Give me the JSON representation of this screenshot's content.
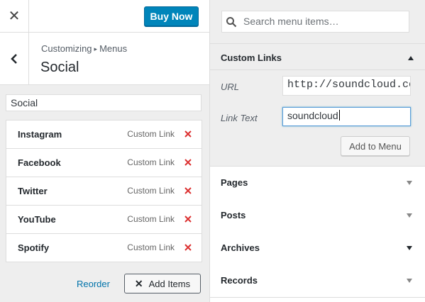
{
  "header": {
    "close_icon": "close-icon",
    "buy_label": "Buy Now",
    "buy_color": "#0085ba"
  },
  "title": {
    "breadcrumb_1": "Customizing",
    "breadcrumb_2": "Menus",
    "section": "Social"
  },
  "menu": {
    "name": "Social",
    "items": [
      {
        "label": "Instagram",
        "type": "Custom Link"
      },
      {
        "label": "Facebook",
        "type": "Custom Link"
      },
      {
        "label": "Twitter",
        "type": "Custom Link"
      },
      {
        "label": "YouTube",
        "type": "Custom Link"
      },
      {
        "label": "Spotify",
        "type": "Custom Link"
      }
    ],
    "delete_color": "#dc3232",
    "reorder_label": "Reorder",
    "add_items_label": "Add Items"
  },
  "search": {
    "placeholder": "Search menu items…"
  },
  "custom_links": {
    "title": "Custom Links",
    "url_label": "URL",
    "url_value": "http://soundcloud.co",
    "text_label": "Link Text",
    "text_value": "soundcloud",
    "add_button": "Add to Menu"
  },
  "sections": [
    {
      "label": "Pages"
    },
    {
      "label": "Posts"
    },
    {
      "label": "Archives"
    },
    {
      "label": "Records"
    }
  ]
}
